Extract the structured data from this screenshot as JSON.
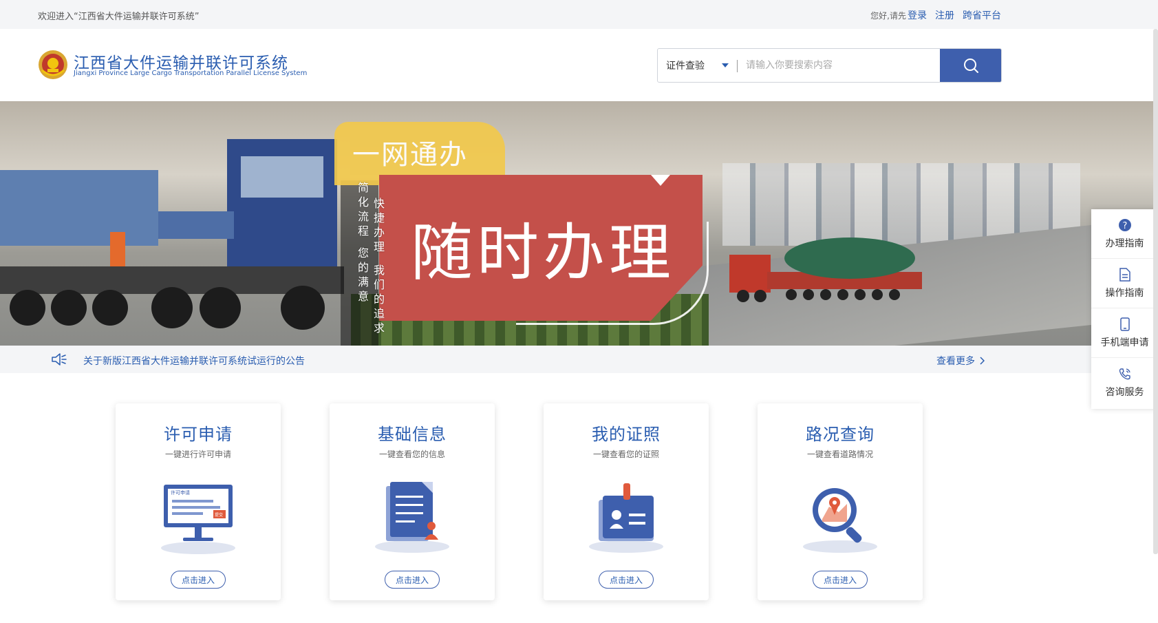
{
  "topbar": {
    "welcome": "欢迎进入“江西省大件运输并联许可系统”",
    "greeting": "您好,请先",
    "login": "登录",
    "register": "注册",
    "cross_province": "跨省平台"
  },
  "header": {
    "logo_cn": "江西省大件运输并联许可系统",
    "logo_en": "Jiangxi Province Large Cargo Transportation Parallel License System",
    "search": {
      "select_value": "证件查验",
      "placeholder": "请输入你要搜索内容"
    }
  },
  "banner": {
    "tag": "一网通办",
    "headline": "随时办理",
    "vertical_left_1": "简化流程",
    "vertical_left_2": "您的满意",
    "vertical_right_1": "快捷办理",
    "vertical_right_2": "我们的追求"
  },
  "notice": {
    "text": "关于新版江西省大件运输并联许可系统试运行的公告",
    "more": "查看更多"
  },
  "side": {
    "items": [
      {
        "label": "办理指南",
        "icon": "question-circle-icon"
      },
      {
        "label": "操作指南",
        "icon": "document-icon"
      },
      {
        "label": "手机端申请",
        "icon": "mobile-phone-icon"
      },
      {
        "label": "咨询服务",
        "icon": "phone-call-icon"
      }
    ]
  },
  "cards": [
    {
      "title": "许可申请",
      "sub": "一键进行许可申请",
      "button": "点击进入",
      "icon": "computer-application-icon",
      "illus_text": "许可申请",
      "illus_stamp": "提交"
    },
    {
      "title": "基础信息",
      "sub": "一键查看您的信息",
      "button": "点击进入",
      "icon": "document-user-icon"
    },
    {
      "title": "我的证照",
      "sub": "一键查看您的证照",
      "button": "点击进入",
      "icon": "id-badge-icon"
    },
    {
      "title": "路况查询",
      "sub": "一键查看道路情况",
      "button": "点击进入",
      "icon": "map-search-icon"
    }
  ],
  "colors": {
    "brand": "#2a5db0",
    "button": "#3e5fad",
    "banner_red": "#c4504a",
    "banner_yellow": "#f2c94c"
  }
}
